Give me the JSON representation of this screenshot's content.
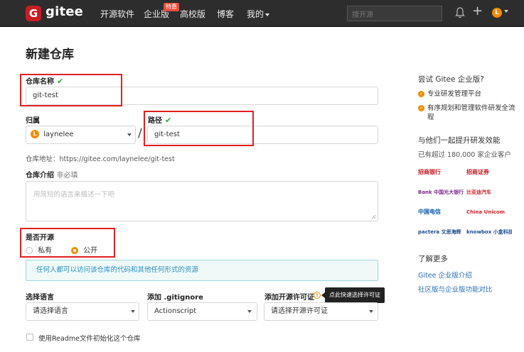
{
  "header": {
    "logo_letter": "G",
    "logo_text": "gitee",
    "nav": [
      "开源软件",
      "企业版",
      "高校版",
      "博客",
      "我的"
    ],
    "nav_badge": "特惠",
    "search_placeholder": "搜开源",
    "avatar_letter": "L",
    "plus_symbol": "+"
  },
  "page": {
    "title": "新建仓库",
    "repo_name_label": "仓库名称",
    "repo_name_value": "git-test",
    "owner_label": "归属",
    "owner_value": "laynelee",
    "owner_avatar_letter": "L",
    "path_separator": "/",
    "path_label": "路径",
    "path_value": "git-test",
    "repo_address": "仓库地址：https://gitee.com/laynelee/git-test",
    "intro_label": "仓库介绍",
    "intro_optional": "非必填",
    "intro_placeholder": "用简短的语言来描述一下吧",
    "open_source_label": "是否开源",
    "option_private": "私有",
    "option_public": "公开",
    "public_info": "任何人都可以访问该仓库的代码和其他任何形式的资源",
    "language_label": "选择语言",
    "language_placeholder": "请选择语言",
    "gitignore_label": "添加 .gitignore",
    "gitignore_value": "Actionscript",
    "license_label": "添加开源许可证",
    "license_placeholder": "请选择开源许可证",
    "license_tooltip": "点此快速选择许可证",
    "readme_label": "使用Readme文件初始化这个仓库",
    "check_mark": "✔",
    "info_icon": "!"
  },
  "sidebar": {
    "try_title": "尝试 Gitee 企业版?",
    "feature_1": "专业研发管理平台",
    "feature_2": "有序规划和管理软件研发全流程",
    "improve_title": "与他们一起提升研发效能",
    "clients_count": "已有超过 180,000 家企业客户",
    "client_logos": [
      "招商银行",
      "招商证券",
      "Bank 中国光大银行",
      "比亚迪汽车",
      "中国电信",
      "China Unicom",
      "pactera 文思海辉",
      "knowbox 小盒科技"
    ],
    "more_title": "了解更多",
    "link_1": "Gitee 企业版介绍",
    "link_2": "社区版与企业版功能对比"
  },
  "colors": {
    "header_bg": "#2d2d2d",
    "brand_red": "#c71d23",
    "accent_orange": "#f08c00",
    "check_green": "#2aa745",
    "highlight_red": "#e02020",
    "link_blue": "#2a6ebb"
  }
}
